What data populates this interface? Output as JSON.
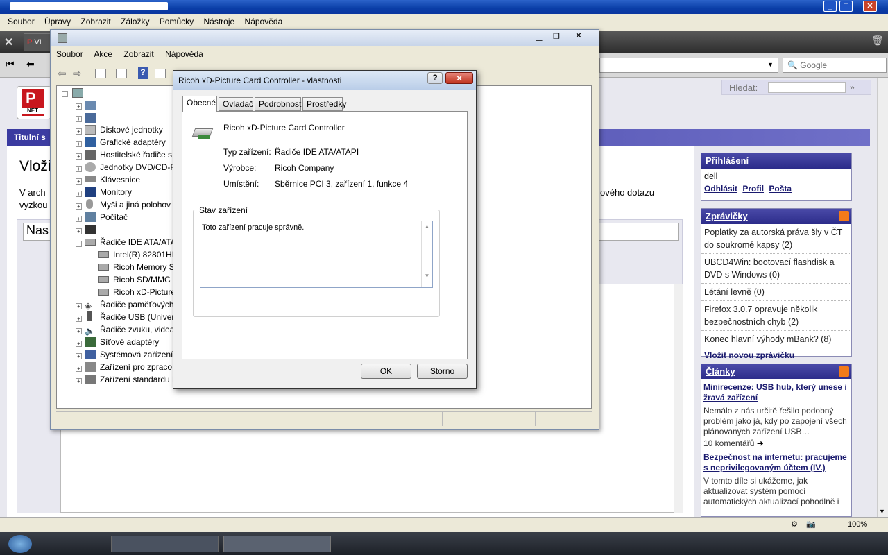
{
  "browser": {
    "menu": [
      "Soubor",
      "Úpravy",
      "Zobrazit",
      "Záložky",
      "Pomůcky",
      "Nástroje",
      "Nápověda"
    ],
    "search_placeholder": "Google",
    "tab_label": "VL"
  },
  "site": {
    "logo_text": "P",
    "logo_sub": "NET",
    "nav_item": "Titulní s",
    "search_label": "Hledat:",
    "search_go": "»",
    "heading": "Vloži",
    "intro_line1": "V arch",
    "intro_line2": "vyzkou",
    "intro_right": "ového dotazu",
    "input_partial": "Nas",
    "login": {
      "title": "Přihlášení",
      "user": "dell",
      "links": [
        "Odhlásit",
        "Profil",
        "Pošta"
      ]
    },
    "news": {
      "title": "Zprávičky",
      "rss": "RSS",
      "items": [
        {
          "text": "Poplatky za autorská práva šly v ČT do soukromé kapsy",
          "count": "(2)"
        },
        {
          "text": "UBCD4Win: bootovací flashdisk a DVD s Windows",
          "count": "(0)"
        },
        {
          "text": "Létání levně",
          "count": "(0)"
        },
        {
          "text": "Firefox 3.0.7 opravuje několik bezpečnostních chyb",
          "count": "(2)"
        },
        {
          "text": "Konec hlavní výhody mBank?",
          "count": "(8)"
        }
      ],
      "add": "Vložit novou zprávičku"
    },
    "articles": {
      "title": "Články",
      "rss": "RSS",
      "a1_title": "Minirecenze: USB hub, který unese i žravá zařízení",
      "a1_text": "Nemálo z nás určitě řešilo podobný problém jako já, kdy po zapojení všech plánovaných zařízení USB…",
      "a1_comments": "10 komentářů",
      "a2_title": "Bezpečnost na internetu: pracujeme s neprivilegovaným účtem (IV.)",
      "a2_text": "V tomto díle si ukážeme, jak aktualizovat systém pomocí automatických aktualizací pohodlně i"
    }
  },
  "devmgr": {
    "menu": [
      "Soubor",
      "Akce",
      "Zobrazit",
      "Nápověda"
    ],
    "nodes": [
      "Diskové jednotky",
      "Grafické adaptéry",
      "Hostitelské řadiče s",
      "Jednotky DVD/CD-R",
      "Klávesnice",
      "Monitory",
      "Myši a jiná polohov",
      "Počítač",
      "",
      "Řadiče IDE ATA/ATA",
      "Intel(R) 82801HE",
      "Ricoh Memory S",
      "Ricoh SD/MMC",
      "Ricoh xD-Picture",
      "Řadiče paměťových",
      "Řadiče USB (Univers",
      "Řadiče zvuku, videa",
      "Síťové adaptéry",
      "Systémová zařízení",
      "Zařízení pro zpraco",
      "Zařízení standardu H"
    ]
  },
  "dialog": {
    "title": "Ricoh xD-Picture Card Controller - vlastnosti",
    "help": "?",
    "close": "×",
    "tabs": [
      "Obecné",
      "Ovladač",
      "Podrobnosti",
      "Prostředky"
    ],
    "device_name": "Ricoh xD-Picture Card Controller",
    "type_label": "Typ zařízení:",
    "type_value": "Řadiče IDE ATA/ATAPI",
    "maker_label": "Výrobce:",
    "maker_value": "Ricoh Company",
    "location_label": "Umístění:",
    "location_value": "Sběrnice PCI 3, zařízení 1, funkce 4",
    "status_group": "Stav zařízení",
    "status_text": "Toto zařízení pracuje správně.",
    "ok": "OK",
    "cancel": "Storno"
  },
  "status": {
    "zoom": "100%"
  }
}
